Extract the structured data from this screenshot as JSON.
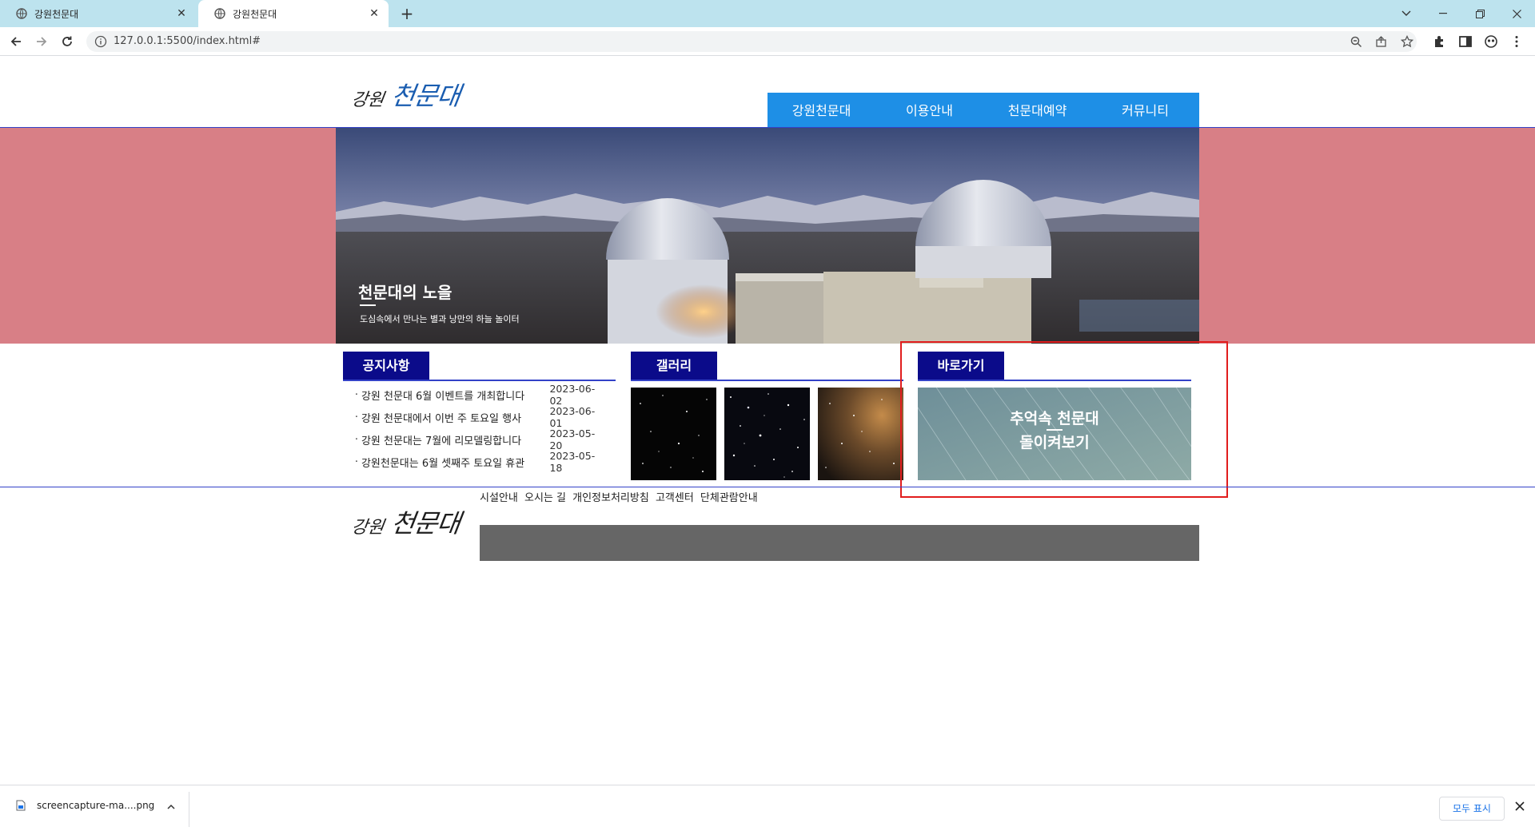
{
  "browser": {
    "tabs": [
      {
        "title": "강원천문대"
      },
      {
        "title": "강원천문대"
      }
    ],
    "url": "127.0.0.1:5500/index.html#"
  },
  "header": {
    "logo_small": "강원",
    "logo_big": "천문대",
    "nav": [
      "강원천문대",
      "이용안내",
      "천문대예약",
      "커뮤니티"
    ]
  },
  "visual": {
    "title": "천문대의 노을",
    "subtitle": "도심속에서 만나는 별과 낭만의 하늘 놀이터"
  },
  "notice": {
    "title": "공지사항",
    "items": [
      {
        "text": "강원 천문대 6월 이벤트를 개최합니다",
        "date": "2023-06-02"
      },
      {
        "text": "강원 천문대에서 이번 주 토요일 행사",
        "date": "2023-06-01"
      },
      {
        "text": "강원 천문대는 7월에 리모델링합니다",
        "date": "2023-05-20"
      },
      {
        "text": "강원천문대는 6월 셋째주 토요일 휴관",
        "date": "2023-05-18"
      }
    ]
  },
  "gallery": {
    "title": "갤러리"
  },
  "quick": {
    "title": "바로가기",
    "line1": "추억속 천문대",
    "line2": "돌이켜보기"
  },
  "footer": {
    "logo_small": "강원",
    "logo_big": "천문대",
    "links": [
      "시설안내",
      "오시는 길",
      "개인정보처리방침",
      "고객센터",
      "단체관람안내"
    ]
  },
  "download": {
    "filename": "screencapture-ma....png",
    "show_all": "모두 표시"
  },
  "colors": {
    "nav": "#1e8fe6",
    "section_label": "#0b0b8a",
    "visual_bg": "#d87f86",
    "rule": "#3342c8",
    "highlight_box": "#e11d1d",
    "footer_box": "#666666"
  }
}
